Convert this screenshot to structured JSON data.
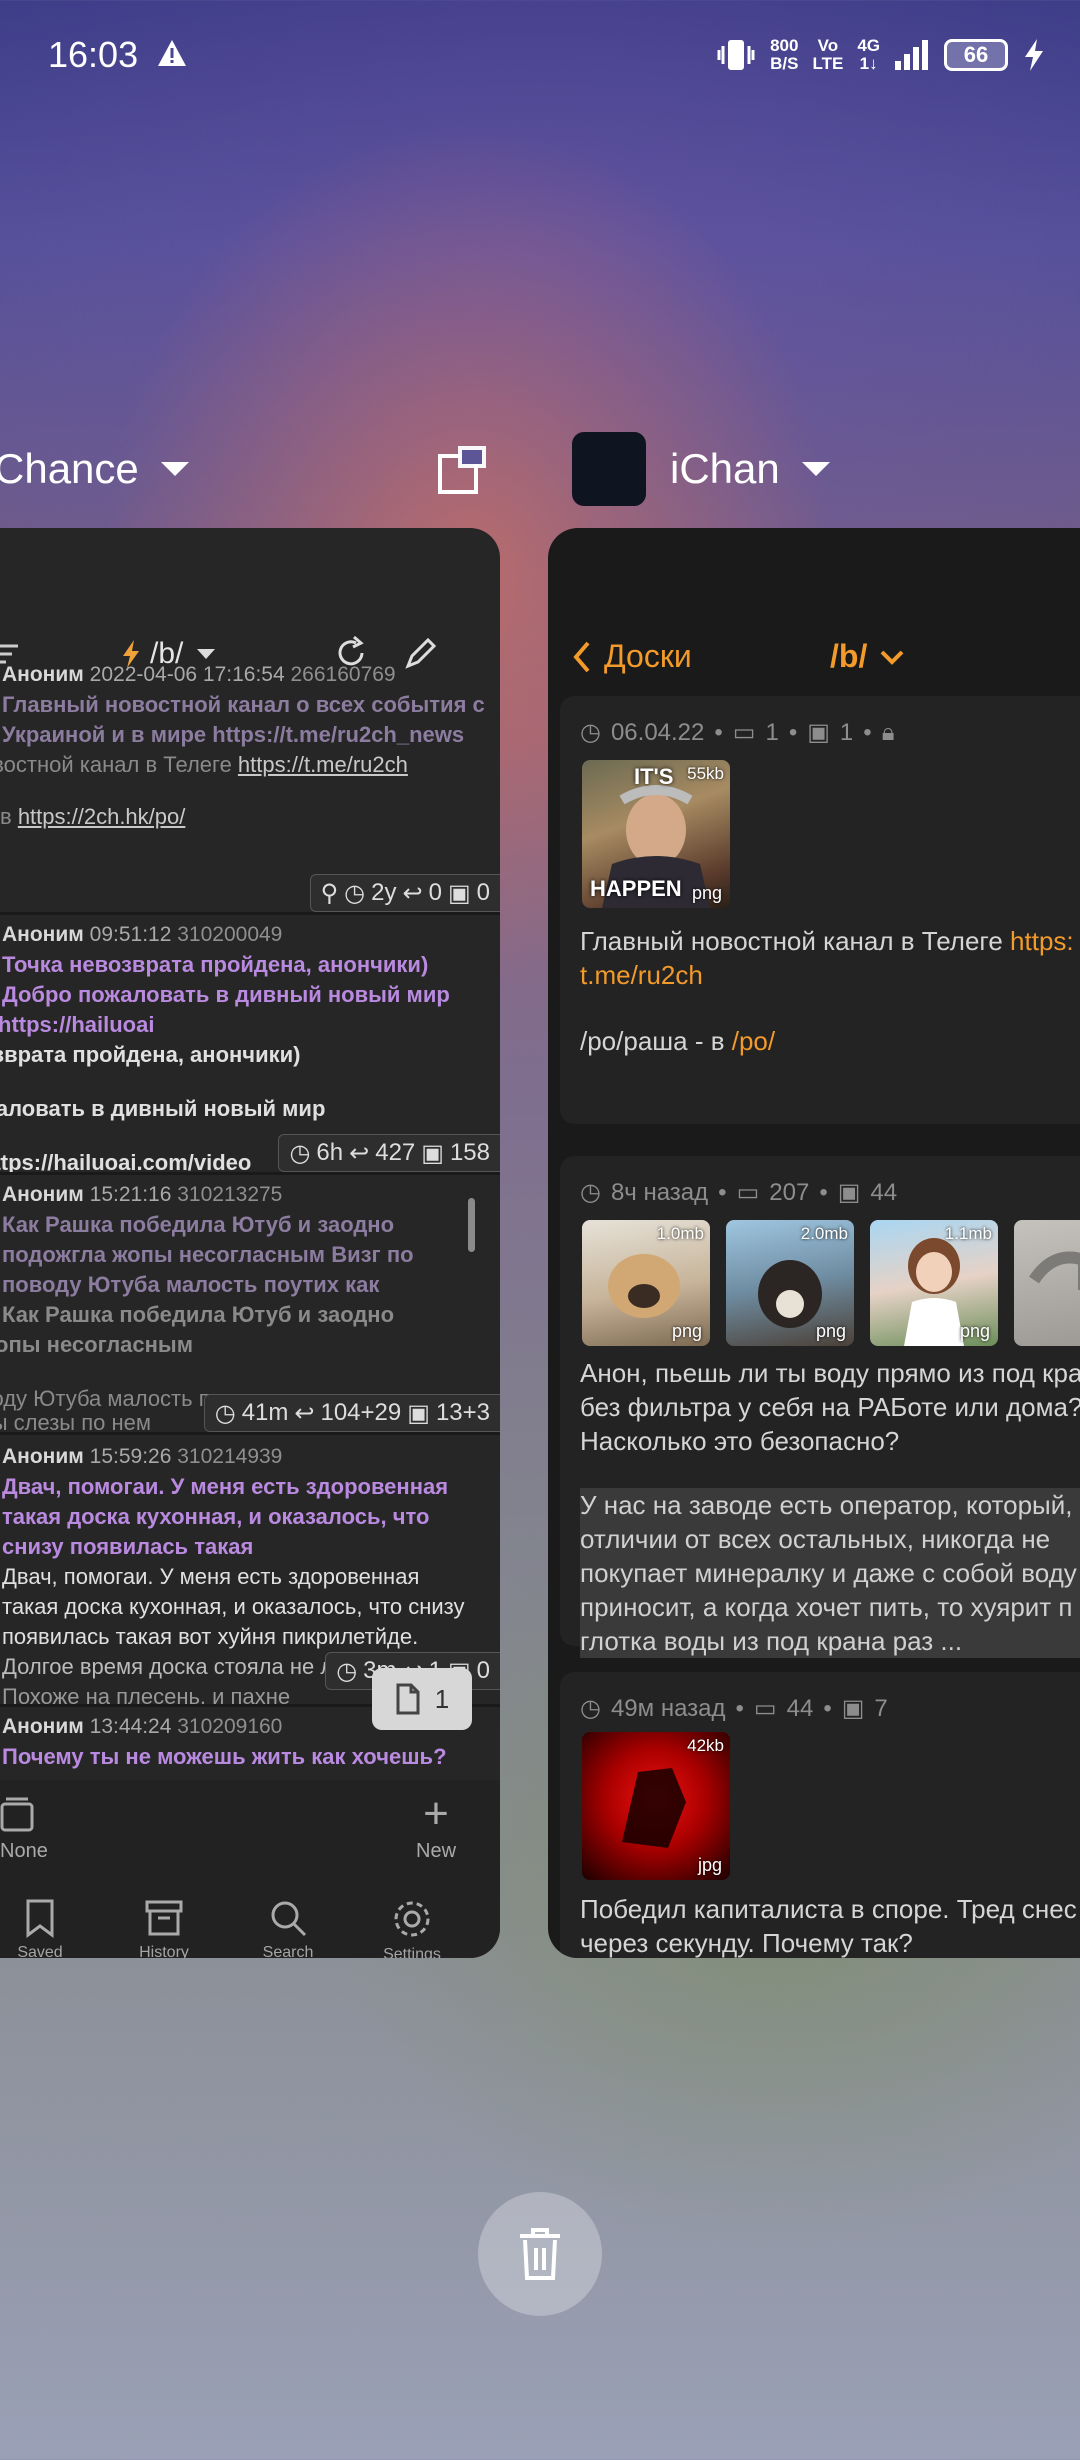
{
  "status_bar": {
    "time": "16:03",
    "net_speed_top": "800",
    "net_speed_bottom": "B/S",
    "volte_top": "Vo",
    "volte_bottom": "LTE",
    "network_top": "4G",
    "network_bottom": "1↓",
    "battery": "66"
  },
  "recents": {
    "left_app_name": "Chance",
    "right_app_name": "iChan"
  },
  "chance": {
    "board": "/b/",
    "posts": [
      {
        "author": "Аноним",
        "date": "2022-04-06 17:16:54",
        "num": "266160769",
        "subject_line1": "Главный новостной канал о всех события с",
        "subject_line2": "Украиной и в мире https://t.me/ru2ch_news",
        "body_line1": "овостной канал в Телеге ",
        "body_link1": "https://t.me/ru2ch",
        "body_line2": "в ",
        "body_link2": "https://2ch.hk/po/",
        "stats": {
          "age": "2y",
          "replies": "0",
          "images": "0"
        }
      },
      {
        "author": "Аноним",
        "date": "09:51:12",
        "num": "310200049",
        "subject_line1": "Точка невозврата пройдена, анончики)",
        "subject_line2": "Добро пожаловать в дивный новый мир",
        "subject_line3": "https://hailuoai",
        "body_line1": "озврата пройдена, анончики)",
        "body_line2": "жаловать в дивный новый мир",
        "body_line3": "https://hailuoai.com/video",
        "stats": {
          "age": "6h",
          "replies": "427",
          "images": "158"
        }
      },
      {
        "author": "Аноним",
        "date": "15:21:16",
        "num": "310213275",
        "subject_line1": "Как Рашка победила Ютуб и заодно",
        "subject_line2": "подожгла жопы несогласным  Визг по",
        "subject_line3": "поводу Ютуба малость поутих как",
        "body_line1": "Как Рашка победила Ютуб и заодно",
        "body_line2": "жопы несогласным",
        "body_line3": "воду Ютуба малость поутих как и",
        "body_line4": "вы слезы по нем",
        "stats": {
          "age": "41m",
          "replies": "104+29",
          "images": "13+3"
        }
      },
      {
        "author": "Аноним",
        "date": "15:59:26",
        "num": "310214939",
        "subject_line1": "Двач, помогаи. У меня есть здоровенная",
        "subject_line2": "такая доска кухонная, и оказалось, что",
        "subject_line3": "снизу появилась такая",
        "body_line1": "Двач, помогаи. У меня есть здоровенная",
        "body_line2": "такая доска кухонная, и оказалось, что снизу",
        "body_line3": "появилась такая вот хуйня пикрилетйде.",
        "body_line4": "Долгое время доска стояла не лучше воды",
        "body_line5": "Похоже на плесень, и пахне",
        "stats": {
          "age": "3m",
          "replies": "1",
          "images": "0"
        }
      },
      {
        "author": "Аноним",
        "date": "13:44:24",
        "num": "310209160",
        "subject_line1": "Почему ты не можешь жить как хочешь?"
      }
    ],
    "fab_count": "1",
    "tabs_label": "None",
    "new_label": "New",
    "nav": [
      "Saved",
      "History",
      "Search",
      "Settings"
    ]
  },
  "ichan": {
    "back_label": "Доски",
    "board": "/b/",
    "threads": [
      {
        "time": "06.04.22",
        "replies": "1",
        "images": "1",
        "thumb_size": "55kb",
        "thumb_ext": "png",
        "thumb_caption_top": "IT'S",
        "thumb_caption_bottom": "HAPPEN",
        "text_line1": "Главный новостной канал в Телеге ",
        "text_link": "https:",
        "text_line2": "t.me/ru2ch",
        "text_line3": "/po/раша - в ",
        "text_link2": "/po/"
      },
      {
        "time": "8ч назад",
        "replies": "207",
        "images": "44",
        "thumbs": [
          {
            "size": "1.0mb",
            "ext": "png"
          },
          {
            "size": "2.0mb",
            "ext": "png"
          },
          {
            "size": "1.1mb",
            "ext": "png"
          }
        ],
        "text_line1": "Анон, пьешь ли ты воду прямо из под кра",
        "text_line2": "без фильтра у себя на РАБоте или дома?",
        "text_line3": "Насколько это безопасно?",
        "quote_line1": "У нас на заводе есть оператор, который,",
        "quote_line2": "отличии от всех остальных, никогда не",
        "quote_line3": "покупает минералку и даже с собой воду",
        "quote_line4": "приносит, а когда хочет пить, то хуярит п",
        "quote_line5": "глотка воды из под крана раз ..."
      },
      {
        "time": "49м назад",
        "replies": "44",
        "images": "7",
        "thumb_size": "42kb",
        "thumb_ext": "jpg",
        "text_line1": "Победил капиталиста в споре. Тред снес",
        "text_line2": "через секунду. Почему так?"
      }
    ]
  },
  "colors": {
    "ichan_accent": "#f29a2a",
    "chance_subject": "#b98ae0"
  }
}
